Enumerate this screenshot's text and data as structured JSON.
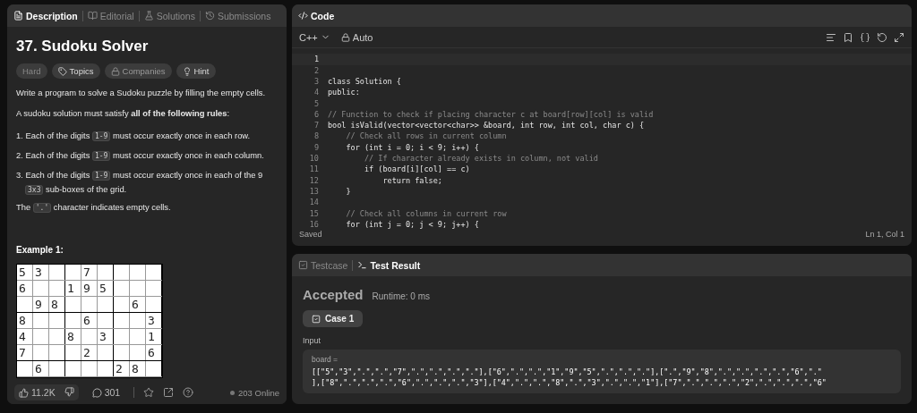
{
  "left_tabs": [
    {
      "label": "Description",
      "selected": true
    },
    {
      "label": "Editorial",
      "selected": false
    },
    {
      "label": "Solutions",
      "selected": false
    },
    {
      "label": "Submissions",
      "selected": false
    }
  ],
  "problem": {
    "title": "37. Sudoku Solver",
    "tags": [
      {
        "label": "Hard",
        "kind": "difficulty"
      },
      {
        "label": "Topics",
        "kind": "topics"
      },
      {
        "label": "Companies",
        "kind": "companies"
      },
      {
        "label": "Hint",
        "kind": "hint"
      }
    ],
    "intro": "Write a program to solve a Sudoku puzzle by filling the empty cells.",
    "rules_lead": "A sudoku solution must satisfy **all of the following rules**:",
    "rules": [
      [
        {
          "kind": "text",
          "text": "1. Each of the digits "
        },
        {
          "kind": "code",
          "text": "1-9"
        },
        {
          "kind": "text",
          "text": " must occur exactly once in each row."
        }
      ],
      [
        {
          "kind": "text",
          "text": "2. Each of the digits "
        },
        {
          "kind": "code",
          "text": "1-9"
        },
        {
          "kind": "text",
          "text": " must occur exactly once in each column."
        }
      ],
      [
        {
          "kind": "text",
          "text": "3. Each of the digits "
        },
        {
          "kind": "code",
          "text": "1-9"
        },
        {
          "kind": "text",
          "text": " must occur exactly once in each of the 9 "
        },
        {
          "kind": "code",
          "text": "3x3"
        },
        {
          "kind": "text",
          "text": " sub-boxes of the grid."
        }
      ]
    ],
    "note": [
      {
        "kind": "text",
        "text": "The "
      },
      {
        "kind": "code",
        "text": "'.'"
      },
      {
        "kind": "text",
        "text": " character indicates empty cells."
      }
    ],
    "example_title": "Example 1:",
    "grid": [
      "53  7",
      "6  195",
      " 98    6",
      "8   6   3",
      "4  8 3  1",
      "7   2   6",
      " 6    28"
    ]
  },
  "footer": {
    "likes": "11.2K",
    "comments": "301",
    "online": "203 Online"
  },
  "code_panel": {
    "title": "Code",
    "language": "C++",
    "mode": "Auto",
    "status": "Saved",
    "cursor": "Ln 1, Col 1",
    "lines": [
      {
        "num": "1",
        "selected": true
      },
      {
        "num": "2",
        "selected": false
      },
      {
        "num": "3",
        "text": "class Solution {",
        "kind": "code",
        "selected": false
      },
      {
        "num": "4",
        "text": "public:",
        "kind": "code",
        "selected": false
      },
      {
        "num": "5",
        "selected": false
      },
      {
        "num": "6",
        "text": "// Function to check if placing character c at board[row][col] is valid",
        "kind": "comment",
        "selected": false
      },
      {
        "num": "7",
        "text": "bool isValid(vector<vector<char>> &board, int row, int col, char c) {",
        "kind": "code",
        "selected": false
      },
      {
        "num": "8",
        "text": "    // Check all rows in current column",
        "kind": "comment",
        "selected": false
      },
      {
        "num": "9",
        "text": "    for (int i = 0; i < 9; i++) {",
        "kind": "code",
        "selected": false
      },
      {
        "num": "10",
        "text": "        // If character already exists in column, not valid",
        "kind": "comment",
        "selected": false
      },
      {
        "num": "11",
        "text": "        if (board[i][col] == c)",
        "kind": "code",
        "selected": false
      },
      {
        "num": "12",
        "text": "            return false;",
        "kind": "code",
        "selected": false
      },
      {
        "num": "13",
        "text": "    }",
        "kind": "code",
        "selected": false
      },
      {
        "num": "14",
        "selected": false
      },
      {
        "num": "15",
        "text": "    // Check all columns in current row",
        "kind": "comment",
        "selected": false
      },
      {
        "num": "16",
        "text": "    for (int j = 0; j < 9; j++) {",
        "kind": "code",
        "selected": false
      }
    ]
  },
  "test_tabs": [
    {
      "label": "Testcase",
      "selected": false
    },
    {
      "label": "Test Result",
      "selected": true
    }
  ],
  "result": {
    "verdict": "Accepted",
    "runtime": "Runtime: 0 ms",
    "cases": [
      {
        "label": "Case 1",
        "selected": true
      }
    ],
    "input_label": "Input",
    "var_name": "board =",
    "value_lines": [
      "[[\"5\",\"3\",\".\",\".\",\"7\",\".\",\".\",\".\",\".\"],[\"6\",\".\",\".\",\"1\",\"9\",\"5\",\".\",\".\",\".\"],[\".\",\"9\",\"8\",\".\",\".\",\".\",\".\",\"6\",\".\"",
      "],[\"8\",\".\",\".\",\".\",\"6\",\".\",\".\",\".\",\"3\"],[\"4\",\".\",\".\",\"8\",\".\",\"3\",\".\",\".\",\"1\"],[\"7\",\".\",\".\",\".\",\"2\",\".\",\".\",\".\",\"6\""
    ]
  }
}
